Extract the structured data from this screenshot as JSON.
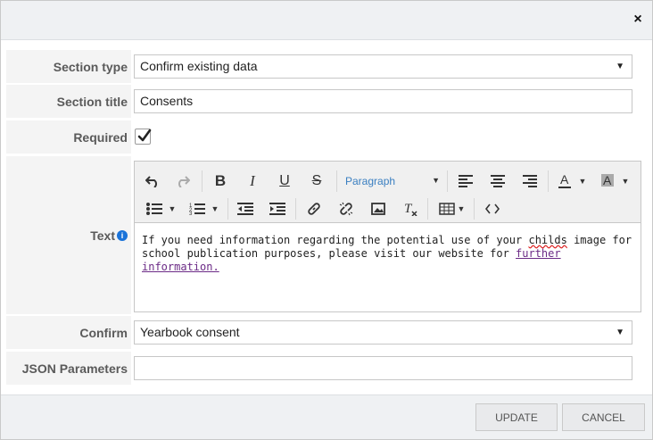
{
  "dialog": {
    "close_label": "×"
  },
  "form": {
    "section_type": {
      "label": "Section type",
      "value": "Confirm existing data"
    },
    "section_title": {
      "label": "Section title",
      "value": "Consents"
    },
    "required": {
      "label": "Required",
      "checked": true
    },
    "text": {
      "label": "Text",
      "toolbar": {
        "paragraph_label": "Paragraph"
      },
      "content": {
        "part1": "If you need information regarding the potential use of your ",
        "misspelled": "childs",
        "part2": " image for school publication purposes, please visit our website for ",
        "link_text": "further information."
      }
    },
    "confirm": {
      "label": "Confirm",
      "value": "Yearbook consent"
    },
    "json_parameters": {
      "label": "JSON Parameters",
      "value": ""
    }
  },
  "footer": {
    "update_label": "UPDATE",
    "cancel_label": "CANCEL"
  },
  "colors": {
    "header_bg": "#eff1f3",
    "label_bg": "#f4f4f4",
    "link": "#6b2a86",
    "paragraph_select_text": "#3a7fc1",
    "info_icon": "#1a73d9"
  }
}
